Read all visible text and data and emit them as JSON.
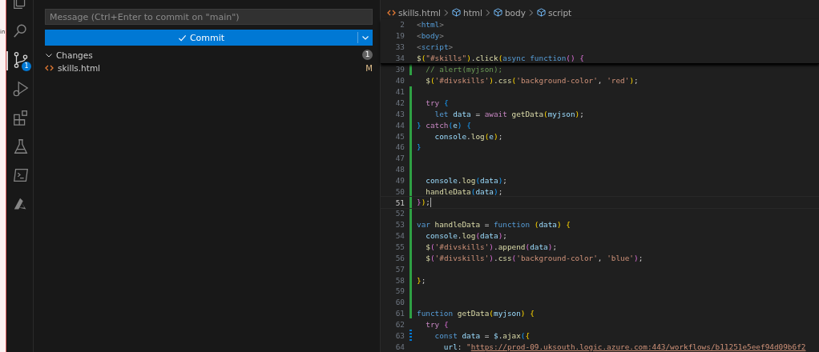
{
  "background_window": {
    "text": "in"
  },
  "activity_bar": [
    {
      "kind": "explorer",
      "selected": false
    },
    {
      "kind": "search",
      "selected": false
    },
    {
      "kind": "source-control",
      "selected": true,
      "badge": "1"
    },
    {
      "kind": "run",
      "selected": false
    },
    {
      "kind": "extensions",
      "selected": false
    },
    {
      "kind": "testing",
      "selected": false
    },
    {
      "kind": "terminal",
      "selected": false
    },
    {
      "kind": "azure",
      "selected": false
    }
  ],
  "source_control": {
    "message": {
      "placeholder": "Message (Ctrl+Enter to commit on \"main\")"
    },
    "commit_button": "Commit",
    "changes": {
      "label": "Changes",
      "expanded": true,
      "count": "1",
      "files": [
        {
          "name": "skills.html",
          "status": "M"
        }
      ]
    }
  },
  "breadcrumb": [
    "skills.html",
    "html",
    "body",
    "script"
  ],
  "sticky_lines": [
    {
      "number": "2",
      "tokens": [
        {
          "kind": "tag",
          "text": "<"
        },
        {
          "kind": "tagname",
          "text": "html"
        },
        {
          "kind": "tag",
          "text": ">"
        }
      ]
    },
    {
      "number": "19",
      "tokens": [
        {
          "kind": "tag",
          "text": "<"
        },
        {
          "kind": "tagname",
          "text": "body"
        },
        {
          "kind": "tag",
          "text": ">"
        }
      ]
    },
    {
      "number": "33",
      "tokens": [
        {
          "kind": "tag",
          "text": "<"
        },
        {
          "kind": "tagname",
          "text": "script"
        },
        {
          "kind": "tag",
          "text": ">"
        }
      ]
    },
    {
      "number": "34",
      "tokens": [
        {
          "kind": "func",
          "text": "$"
        },
        {
          "kind": "b1",
          "text": "("
        },
        {
          "kind": "string",
          "text": "\"#skills\""
        },
        {
          "kind": "b1",
          "text": ")"
        },
        {
          "kind": "plain",
          "text": "."
        },
        {
          "kind": "func",
          "text": "click"
        },
        {
          "kind": "b1",
          "text": "("
        },
        {
          "kind": "storage",
          "text": "async function"
        },
        {
          "kind": "b2",
          "text": "() {"
        }
      ]
    }
  ],
  "lines": [
    {
      "number": "39",
      "added": true,
      "modified": false,
      "current": false,
      "tokens": [
        {
          "kind": "comment",
          "text": "  // alert(myjson);"
        }
      ]
    },
    {
      "number": "40",
      "added": false,
      "modified": false,
      "current": false,
      "tokens": [
        {
          "kind": "func",
          "text": "  $"
        },
        {
          "kind": "b1",
          "text": "("
        },
        {
          "kind": "string",
          "text": "'#divskills'"
        },
        {
          "kind": "b1",
          "text": ")"
        },
        {
          "kind": "plain",
          "text": "."
        },
        {
          "kind": "func",
          "text": "css"
        },
        {
          "kind": "b1",
          "text": "("
        },
        {
          "kind": "string",
          "text": "'background-color'"
        },
        {
          "kind": "plain",
          "text": ", "
        },
        {
          "kind": "string",
          "text": "'red'"
        },
        {
          "kind": "b1",
          "text": ")"
        },
        {
          "kind": "plain",
          "text": ";"
        }
      ]
    },
    {
      "number": "41",
      "added": true,
      "modified": false,
      "current": false
    },
    {
      "number": "42",
      "added": true,
      "modified": false,
      "current": false,
      "tokens": [
        {
          "kind": "keyword",
          "text": "  try "
        },
        {
          "kind": "b3",
          "text": "{"
        }
      ]
    },
    {
      "number": "43",
      "added": true,
      "modified": false,
      "current": false,
      "tokens": [
        {
          "kind": "storage",
          "text": "    let "
        },
        {
          "kind": "var",
          "text": "data"
        },
        {
          "kind": "plain",
          "text": " = "
        },
        {
          "kind": "keyword",
          "text": "await "
        },
        {
          "kind": "func",
          "text": "getData"
        },
        {
          "kind": "b1",
          "text": "("
        },
        {
          "kind": "var",
          "text": "myjson"
        },
        {
          "kind": "b1",
          "text": ")"
        },
        {
          "kind": "plain",
          "text": ";"
        }
      ]
    },
    {
      "number": "44",
      "added": true,
      "modified": false,
      "current": false,
      "tokens": [
        {
          "kind": "b3",
          "text": "} "
        },
        {
          "kind": "keyword",
          "text": "catch"
        },
        {
          "kind": "b3",
          "text": "("
        },
        {
          "kind": "var",
          "text": "e"
        },
        {
          "kind": "b3",
          "text": ")"
        },
        {
          "kind": "b3",
          "text": " {"
        }
      ]
    },
    {
      "number": "45",
      "added": true,
      "modified": false,
      "current": false,
      "tokens": [
        {
          "kind": "var",
          "text": "    console"
        },
        {
          "kind": "plain",
          "text": "."
        },
        {
          "kind": "func",
          "text": "log"
        },
        {
          "kind": "b1",
          "text": "("
        },
        {
          "kind": "var",
          "text": "e"
        },
        {
          "kind": "b1",
          "text": ")"
        },
        {
          "kind": "plain",
          "text": ";"
        }
      ]
    },
    {
      "number": "46",
      "added": true,
      "modified": false,
      "current": false,
      "tokens": [
        {
          "kind": "b3",
          "text": "}"
        }
      ]
    },
    {
      "number": "47",
      "added": true,
      "modified": false,
      "current": false
    },
    {
      "number": "48",
      "added": true,
      "modified": false,
      "current": false
    },
    {
      "number": "49",
      "added": true,
      "modified": false,
      "current": false,
      "tokens": [
        {
          "kind": "var",
          "text": "  console"
        },
        {
          "kind": "plain",
          "text": "."
        },
        {
          "kind": "func",
          "text": "log"
        },
        {
          "kind": "b3",
          "text": "("
        },
        {
          "kind": "var",
          "text": "data"
        },
        {
          "kind": "b3",
          "text": ")"
        },
        {
          "kind": "plain",
          "text": ";"
        }
      ]
    },
    {
      "number": "50",
      "added": true,
      "modified": false,
      "current": false,
      "tokens": [
        {
          "kind": "func",
          "text": "  handleData"
        },
        {
          "kind": "b3",
          "text": "("
        },
        {
          "kind": "var",
          "text": "data"
        },
        {
          "kind": "b3",
          "text": ")"
        },
        {
          "kind": "plain",
          "text": ";"
        }
      ]
    },
    {
      "number": "51",
      "added": true,
      "modified": false,
      "current": true,
      "tokens": [
        {
          "kind": "b2",
          "text": "}"
        },
        {
          "kind": "b1",
          "text": ")"
        },
        {
          "kind": "plain",
          "text": ";"
        }
      ]
    },
    {
      "number": "52",
      "added": true,
      "modified": false,
      "current": false
    },
    {
      "number": "53",
      "added": true,
      "modified": false,
      "current": false,
      "tokens": [
        {
          "kind": "storage",
          "text": "var "
        },
        {
          "kind": "func",
          "text": "handleData"
        },
        {
          "kind": "plain",
          "text": " = "
        },
        {
          "kind": "storage",
          "text": "function "
        },
        {
          "kind": "b1",
          "text": "("
        },
        {
          "kind": "var",
          "text": "data"
        },
        {
          "kind": "b1",
          "text": ")"
        },
        {
          "kind": "b1",
          "text": " {"
        }
      ]
    },
    {
      "number": "54",
      "added": true,
      "modified": false,
      "current": false,
      "tokens": [
        {
          "kind": "var",
          "text": "  console"
        },
        {
          "kind": "plain",
          "text": "."
        },
        {
          "kind": "func",
          "text": "log"
        },
        {
          "kind": "b2",
          "text": "("
        },
        {
          "kind": "var",
          "text": "data"
        },
        {
          "kind": "b2",
          "text": ")"
        },
        {
          "kind": "plain",
          "text": ";"
        }
      ]
    },
    {
      "number": "55",
      "added": true,
      "modified": false,
      "current": false,
      "tokens": [
        {
          "kind": "func",
          "text": "  $"
        },
        {
          "kind": "b2",
          "text": "("
        },
        {
          "kind": "string",
          "text": "'#divskills'"
        },
        {
          "kind": "b2",
          "text": ")"
        },
        {
          "kind": "plain",
          "text": "."
        },
        {
          "kind": "func",
          "text": "append"
        },
        {
          "kind": "b2",
          "text": "("
        },
        {
          "kind": "var",
          "text": "data"
        },
        {
          "kind": "b2",
          "text": ")"
        },
        {
          "kind": "plain",
          "text": ";"
        }
      ]
    },
    {
      "number": "56",
      "added": true,
      "modified": false,
      "current": false,
      "tokens": [
        {
          "kind": "func",
          "text": "  $"
        },
        {
          "kind": "b2",
          "text": "("
        },
        {
          "kind": "string",
          "text": "'#divskills'"
        },
        {
          "kind": "b2",
          "text": ")"
        },
        {
          "kind": "plain",
          "text": "."
        },
        {
          "kind": "func",
          "text": "css"
        },
        {
          "kind": "b2",
          "text": "("
        },
        {
          "kind": "string",
          "text": "'background-color'"
        },
        {
          "kind": "plain",
          "text": ", "
        },
        {
          "kind": "string",
          "text": "'blue'"
        },
        {
          "kind": "b2",
          "text": ")"
        },
        {
          "kind": "plain",
          "text": ";"
        }
      ]
    },
    {
      "number": "57",
      "added": true,
      "modified": false,
      "current": false
    },
    {
      "number": "58",
      "added": true,
      "modified": false,
      "current": false,
      "tokens": [
        {
          "kind": "b1",
          "text": "}"
        },
        {
          "kind": "plain",
          "text": ";"
        }
      ]
    },
    {
      "number": "59",
      "added": true,
      "modified": false,
      "current": false
    },
    {
      "number": "60",
      "added": true,
      "modified": false,
      "current": false
    },
    {
      "number": "61",
      "added": true,
      "modified": false,
      "current": false,
      "tokens": [
        {
          "kind": "storage",
          "text": "function "
        },
        {
          "kind": "func",
          "text": "getData"
        },
        {
          "kind": "b1",
          "text": "("
        },
        {
          "kind": "var",
          "text": "myjson"
        },
        {
          "kind": "b1",
          "text": ")"
        },
        {
          "kind": "b1",
          "text": " {"
        }
      ]
    },
    {
      "number": "62",
      "added": false,
      "modified": false,
      "current": false,
      "tokens": [
        {
          "kind": "keyword",
          "text": "  try "
        },
        {
          "kind": "b2",
          "text": "{"
        }
      ]
    },
    {
      "number": "63",
      "added": false,
      "modified": true,
      "current": false,
      "tokens": [
        {
          "kind": "storage",
          "text": "    const "
        },
        {
          "kind": "var",
          "text": "data"
        },
        {
          "kind": "plain",
          "text": " = "
        },
        {
          "kind": "var",
          "text": "$"
        },
        {
          "kind": "plain",
          "text": "."
        },
        {
          "kind": "func",
          "text": "ajax"
        },
        {
          "kind": "b3",
          "text": "("
        },
        {
          "kind": "b1",
          "text": "{"
        }
      ]
    },
    {
      "number": "64",
      "added": false,
      "modified": false,
      "current": false,
      "tokens": [
        {
          "kind": "var",
          "text": "      url"
        },
        {
          "kind": "plain",
          "text": ": "
        },
        {
          "kind": "string",
          "text": "\""
        },
        {
          "kind": "url",
          "text": "https://prod-09.uksouth.logic.azure.com:443/workflows/b11251e5eef94d09b6f2"
        }
      ]
    }
  ]
}
